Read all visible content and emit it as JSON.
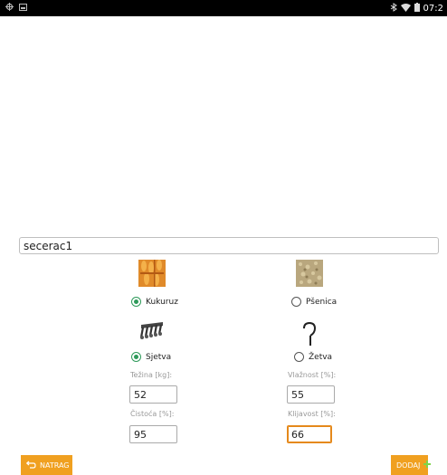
{
  "statusbar": {
    "time": "07:2"
  },
  "name_field": {
    "value": "secerac1"
  },
  "crops": {
    "kukuruz": {
      "label": "Kukuruz",
      "checked": true
    },
    "psenica": {
      "label": "Pšenica",
      "checked": false
    }
  },
  "operations": {
    "sjetva": {
      "label": "Sjetva",
      "checked": true
    },
    "zetva": {
      "label": "Žetva",
      "checked": false
    }
  },
  "fields": {
    "tezina": {
      "label": "Težina [kg]:",
      "value": "52"
    },
    "vlaznost": {
      "label": "Vlažnost [%]:",
      "value": "55"
    },
    "cistoca": {
      "label": "Čistoća [%]:",
      "value": "95"
    },
    "klijavost": {
      "label": "Klijavost [%]:",
      "value": "66"
    }
  },
  "buttons": {
    "back": "NATRAG",
    "add": "DODAJ"
  },
  "colors": {
    "accent": "#f0a020",
    "radio": "#2e9a5a",
    "focus": "#e5891b"
  }
}
